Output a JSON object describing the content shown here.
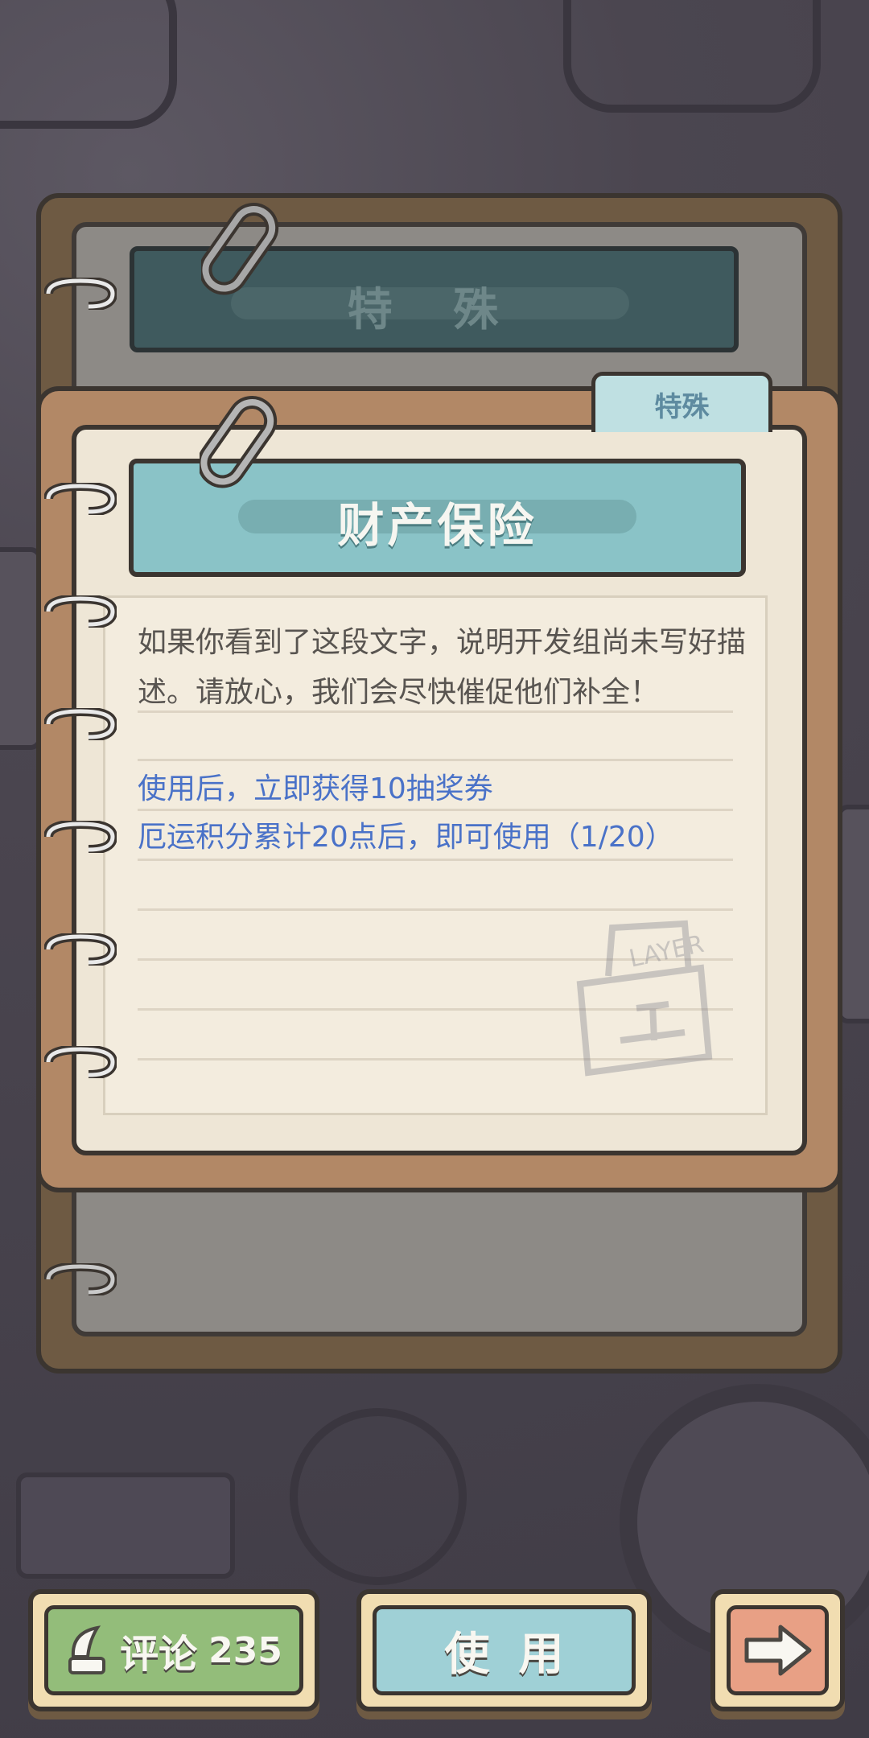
{
  "back_page": {
    "title": "特 殊"
  },
  "item_card": {
    "category_tab": "特殊",
    "title": "财产保险",
    "description": "如果你看到了这段文字，说明开发组尚未写好描述。请放心，我们会尽快催促他们补全！",
    "effect_line": "使用后，立即获得10抽奖券",
    "requirement_line": "厄运积分累计20点后，即可使用（1/20）"
  },
  "buttons": {
    "comment_label": "评论",
    "comment_count": "235",
    "use_label": "使用"
  },
  "icons": {
    "comment": "quill-ink-icon",
    "next": "arrow-right-icon",
    "stamp": "layer-bag-stamp-icon"
  },
  "colors": {
    "title_bar": "#8ac3c7",
    "effect_text": "#4a72c8",
    "comment_button": "#93bd7a",
    "use_button": "#9fd0d6",
    "next_button": "#e8a085"
  }
}
